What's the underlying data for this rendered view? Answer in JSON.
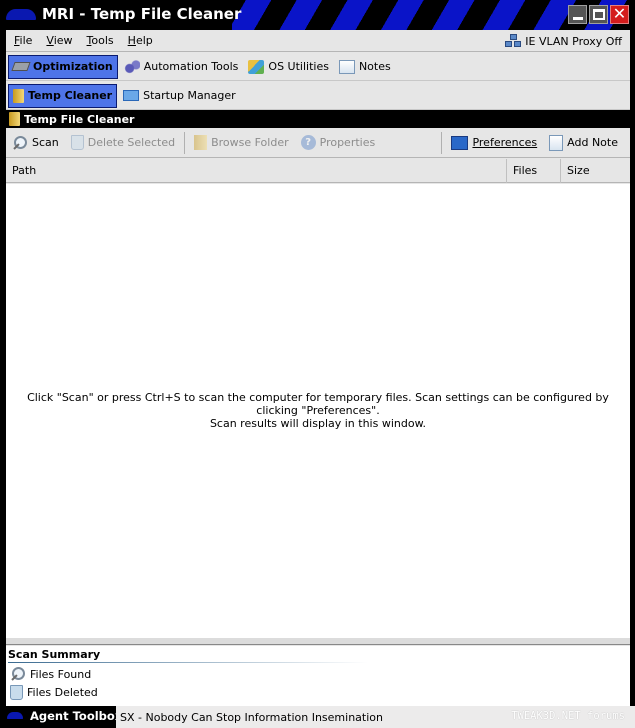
{
  "window": {
    "title": "MRI - Temp File Cleaner",
    "controls": [
      "minimize",
      "maximize",
      "close"
    ]
  },
  "menubar": {
    "items": [
      {
        "label": "File",
        "accel": "F"
      },
      {
        "label": "View",
        "accel": "V"
      },
      {
        "label": "Tools",
        "accel": "T"
      },
      {
        "label": "Help",
        "accel": "H"
      }
    ],
    "proxy_status": "IE VLAN Proxy Off",
    "proxy_icon": "network-icon"
  },
  "main_tabs": [
    {
      "label": "Optimization",
      "icon": "chip-icon",
      "active": true
    },
    {
      "label": "Automation Tools",
      "icon": "gears-icon",
      "active": false
    },
    {
      "label": "OS Utilities",
      "icon": "control-panel-icon",
      "active": false
    },
    {
      "label": "Notes",
      "icon": "notepad-icon",
      "active": false
    }
  ],
  "sub_tabs": [
    {
      "label": "Temp Cleaner",
      "icon": "folder-icon",
      "active": true
    },
    {
      "label": "Startup Manager",
      "icon": "startup-icon",
      "active": false
    }
  ],
  "section": {
    "title": "Temp File Cleaner"
  },
  "toolbar": {
    "scan": "Scan",
    "delete_selected": "Delete Selected",
    "browse_folder": "Browse Folder",
    "properties": "Properties",
    "preferences": "Preferences",
    "add_note": "Add Note"
  },
  "list": {
    "columns": [
      "Path",
      "Files",
      "Size"
    ],
    "rows": [],
    "hint_line1": "Click \"Scan\" or press Ctrl+S to scan the computer for temporary files.  Scan settings can be configured by clicking \"Preferences\".",
    "hint_line2": "Scan results will display in this window."
  },
  "summary": {
    "title": "Scan Summary",
    "files_found": "Files Found",
    "files_deleted": "Files Deleted"
  },
  "taskbar": {
    "agent_label": "Agent Toolbox",
    "status": "SX - Nobody Can Stop Information Insemination",
    "watermark": "TWEAK3D.NET forums"
  },
  "colors": {
    "accent_blue": "#0a14c8",
    "tab_active": "#4e74e8",
    "close_red": "#d41c1c"
  }
}
